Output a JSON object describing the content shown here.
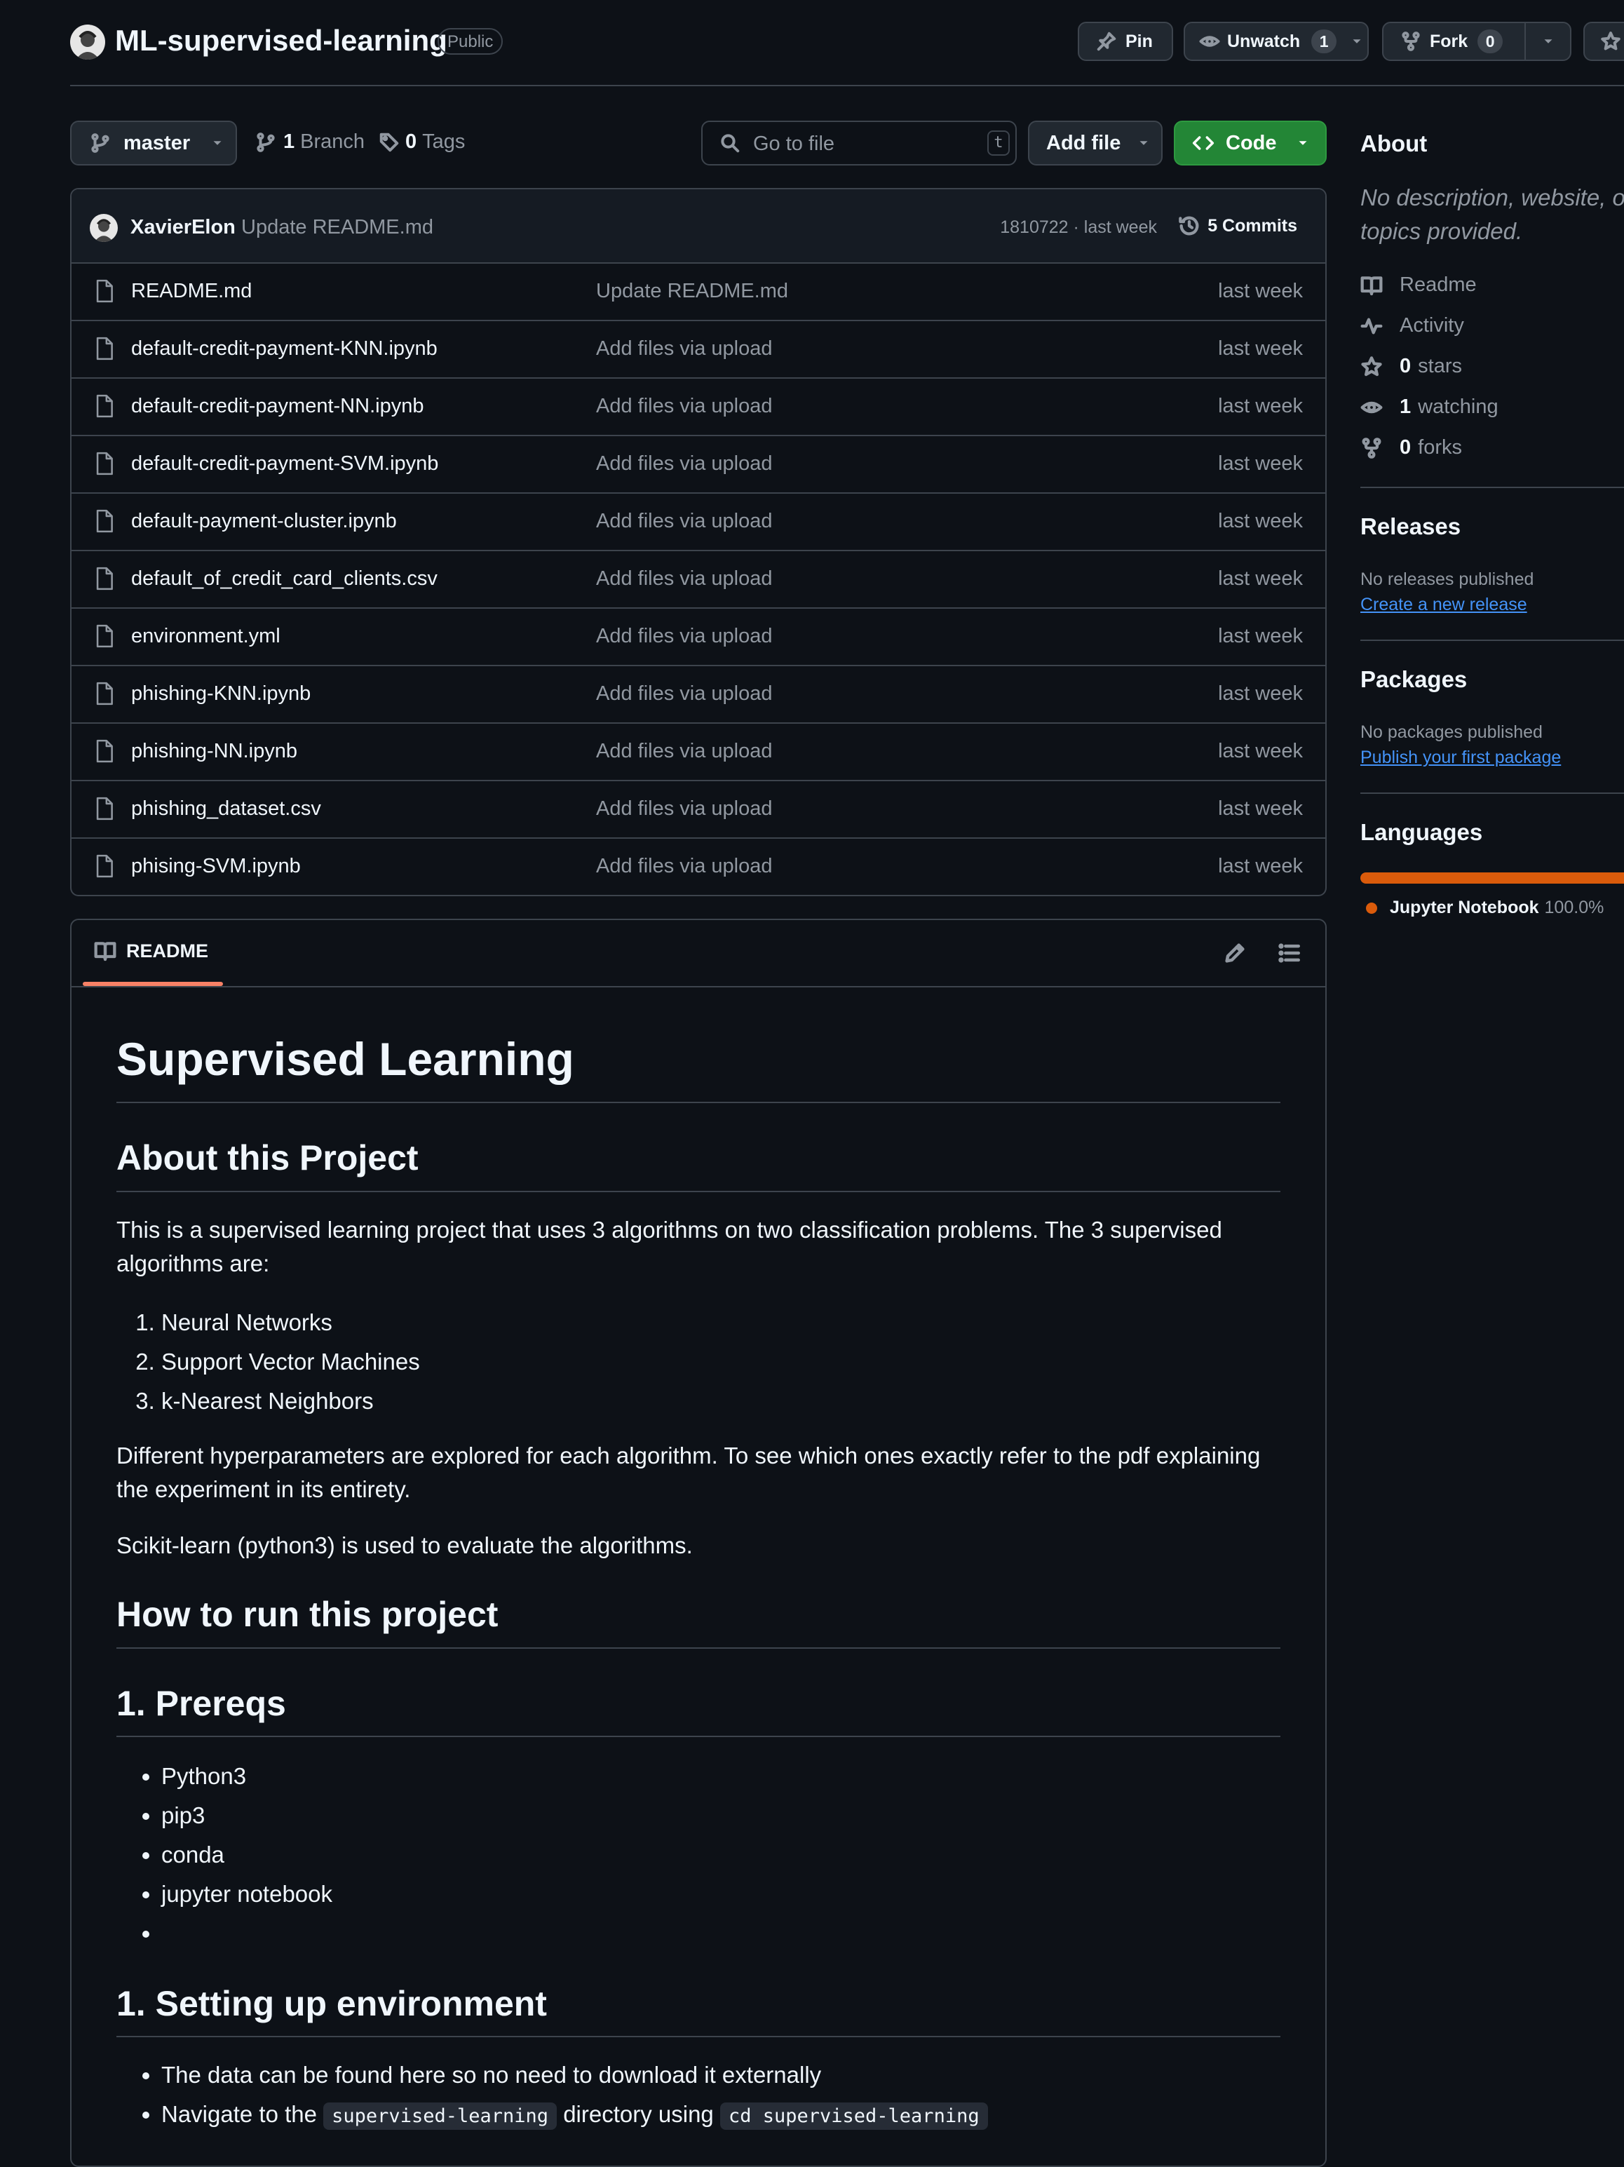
{
  "repo": {
    "name": "ML-supervised-learning",
    "visibility": "Public"
  },
  "header_actions": {
    "pin": "Pin",
    "unwatch": "Unwatch",
    "watch_count": "1",
    "fork": "Fork",
    "fork_count": "0"
  },
  "toolbar": {
    "branch": "master",
    "branch_count": "1",
    "branch_label": "Branch",
    "tag_count": "0",
    "tag_label": "Tags",
    "search_placeholder": "Go to file",
    "search_shortcut": "t",
    "add_file": "Add file",
    "code": "Code"
  },
  "latest_commit": {
    "author": "XavierElon",
    "message": "Update README.md",
    "hash_time": "1810722 · last week",
    "commits": "5 Commits"
  },
  "files": [
    {
      "name": "README.md",
      "message": "Update README.md",
      "time": "last week"
    },
    {
      "name": "default-credit-payment-KNN.ipynb",
      "message": "Add files via upload",
      "time": "last week"
    },
    {
      "name": "default-credit-payment-NN.ipynb",
      "message": "Add files via upload",
      "time": "last week"
    },
    {
      "name": "default-credit-payment-SVM.ipynb",
      "message": "Add files via upload",
      "time": "last week"
    },
    {
      "name": "default-payment-cluster.ipynb",
      "message": "Add files via upload",
      "time": "last week"
    },
    {
      "name": "default_of_credit_card_clients.csv",
      "message": "Add files via upload",
      "time": "last week"
    },
    {
      "name": "environment.yml",
      "message": "Add files via upload",
      "time": "last week"
    },
    {
      "name": "phishing-KNN.ipynb",
      "message": "Add files via upload",
      "time": "last week"
    },
    {
      "name": "phishing-NN.ipynb",
      "message": "Add files via upload",
      "time": "last week"
    },
    {
      "name": "phishing_dataset.csv",
      "message": "Add files via upload",
      "time": "last week"
    },
    {
      "name": "phising-SVM.ipynb",
      "message": "Add files via upload",
      "time": "last week"
    }
  ],
  "readme": {
    "tab": "README",
    "h1": "Supervised Learning",
    "h2_about": "About this Project",
    "p1": "This is a supervised learning project that uses 3 algorithms on two classification problems. The 3 supervised algorithms are:",
    "algorithms": [
      "Neural Networks",
      "Support Vector Machines",
      "k-Nearest Neighbors"
    ],
    "p2": "Different hyperparameters are explored for each algorithm. To see which ones exactly refer to the pdf explaining the experiment in its entirety.",
    "p3": "Scikit-learn (python3) is used to evaluate the algorithms.",
    "h2_run": "How to run this project",
    "h2_prereqs": "1. Prereqs",
    "prereqs": [
      "Python3",
      "pip3",
      "conda",
      "jupyter notebook",
      ""
    ],
    "h2_setup": "1. Setting up environment",
    "setup_1": "The data can be found here so no need to download it externally",
    "setup_2_pre": "Navigate to the",
    "setup_2_code1": "supervised-learning",
    "setup_2_mid": "directory using",
    "setup_2_code2": "cd supervised-learning"
  },
  "sidebar": {
    "about_title": "About",
    "description": "No description, website, or topics provided.",
    "readme": "Readme",
    "activity": "Activity",
    "stars_count": "0",
    "stars": "stars",
    "watching_count": "1",
    "watching": "watching",
    "forks_count": "0",
    "forks": "forks",
    "releases_title": "Releases",
    "releases_none": "No releases published",
    "releases_link": "Create a new release",
    "packages_title": "Packages",
    "packages_none": "No packages published",
    "packages_link": "Publish your first package",
    "languages_title": "Languages",
    "language_name": "Jupyter Notebook",
    "language_pct": "100.0%",
    "language_color": "#DA5B0B"
  }
}
